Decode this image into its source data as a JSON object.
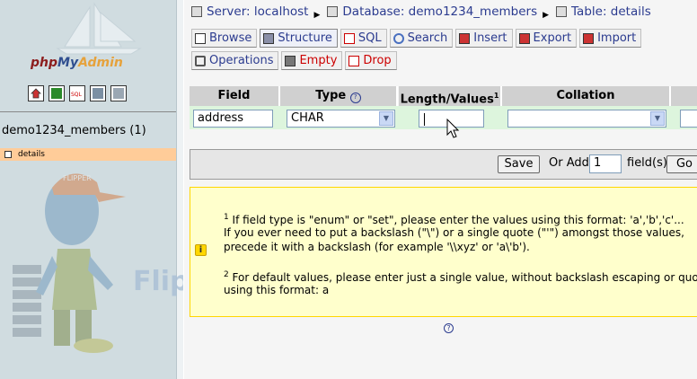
{
  "logo": {
    "part1": "php",
    "part2": "My",
    "part3": "Admin"
  },
  "left_icons": [
    "home-icon",
    "query-window-icon",
    "sql-icon",
    "docs-icon",
    "doc-sql-icon"
  ],
  "sidebar": {
    "db_name": "demo1234_members (1)",
    "table_item": "details"
  },
  "watermark": "FlipperHost",
  "breadcrumb": {
    "server": "Server: localhost",
    "database": "Database: demo1234_members",
    "table": "Table: details"
  },
  "tabs_row1": [
    "Browse",
    "Structure",
    "SQL",
    "Search",
    "Insert",
    "Export",
    "Import"
  ],
  "tabs_row2": [
    "Operations",
    "Empty",
    "Drop"
  ],
  "table": {
    "headers": {
      "field": "Field",
      "type": "Type",
      "length": "Length/Values",
      "length_sup": "1",
      "collation": "Collation"
    },
    "row": {
      "field_value": "address",
      "type_value": "CHAR",
      "length_value": "",
      "collation_value": ""
    }
  },
  "savebar": {
    "save_label": "Save",
    "or_add": "Or Add",
    "add_count": "1",
    "fields_label": "field(s)",
    "go_label": "Go"
  },
  "notice": {
    "n1": "1",
    "line1": " If field type is \"enum\" or \"set\", please enter the values using this format: 'a','b','c'...",
    "line2": "If you ever need to put a backslash (\"\\\") or a single quote (\"'\") amongst those values,",
    "line3": "precede it with a backslash (for example '\\\\xyz' or 'a\\'b').",
    "n2": "2",
    "line4": " For default values, please enter just a single value, without backslash escaping or quotes,",
    "line5": "using this format: a"
  },
  "colors": {
    "link": "#2b3b8f",
    "warn": "#cc0000",
    "row_highlight": "#ddf5dd",
    "notice_bg": "#ffffcc"
  }
}
